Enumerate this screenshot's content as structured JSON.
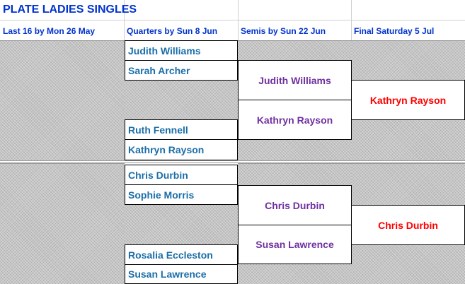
{
  "title": "PLATE LADIES SINGLES",
  "headers": {
    "last16": "Last 16 by Mon 26 May",
    "quarters": "Quarters by Sun 8 Jun",
    "semis": "Semis by Sun 22 Jun",
    "final": "Final Saturday 5 Jul"
  },
  "quarterfinalists": [
    "Judith Williams",
    "Sarah Archer",
    "Ruth Fennell",
    "Kathryn Rayson",
    "Chris Durbin",
    "Sophie Morris",
    "Rosalia Eccleston",
    "Susan Lawrence"
  ],
  "semifinalists": [
    "Judith Williams",
    "Kathryn Rayson",
    "Chris Durbin",
    "Susan Lawrence"
  ],
  "finalists": [
    "Kathryn Rayson",
    "Chris Durbin"
  ],
  "colors": {
    "header": "#0033cc",
    "quarters": "#1b6ea8",
    "semis": "#7030a0",
    "final": "#ff0000"
  }
}
